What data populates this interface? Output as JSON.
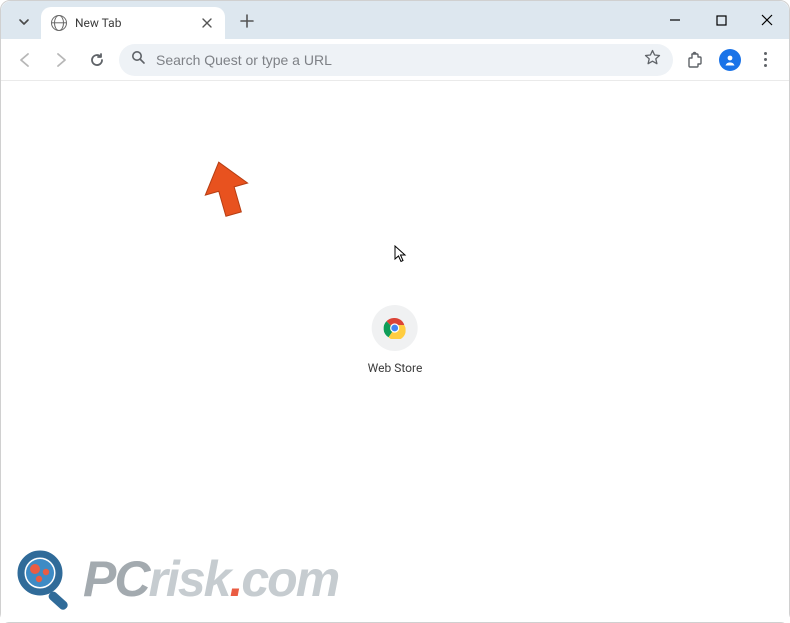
{
  "tab": {
    "title": "New Tab"
  },
  "omnibox": {
    "placeholder": "Search Quest or type a URL"
  },
  "shortcuts": [
    {
      "label": "Web Store"
    }
  ],
  "watermark": {
    "part1": "PC",
    "part2": "risk",
    "dot": ".",
    "part3": "com"
  }
}
